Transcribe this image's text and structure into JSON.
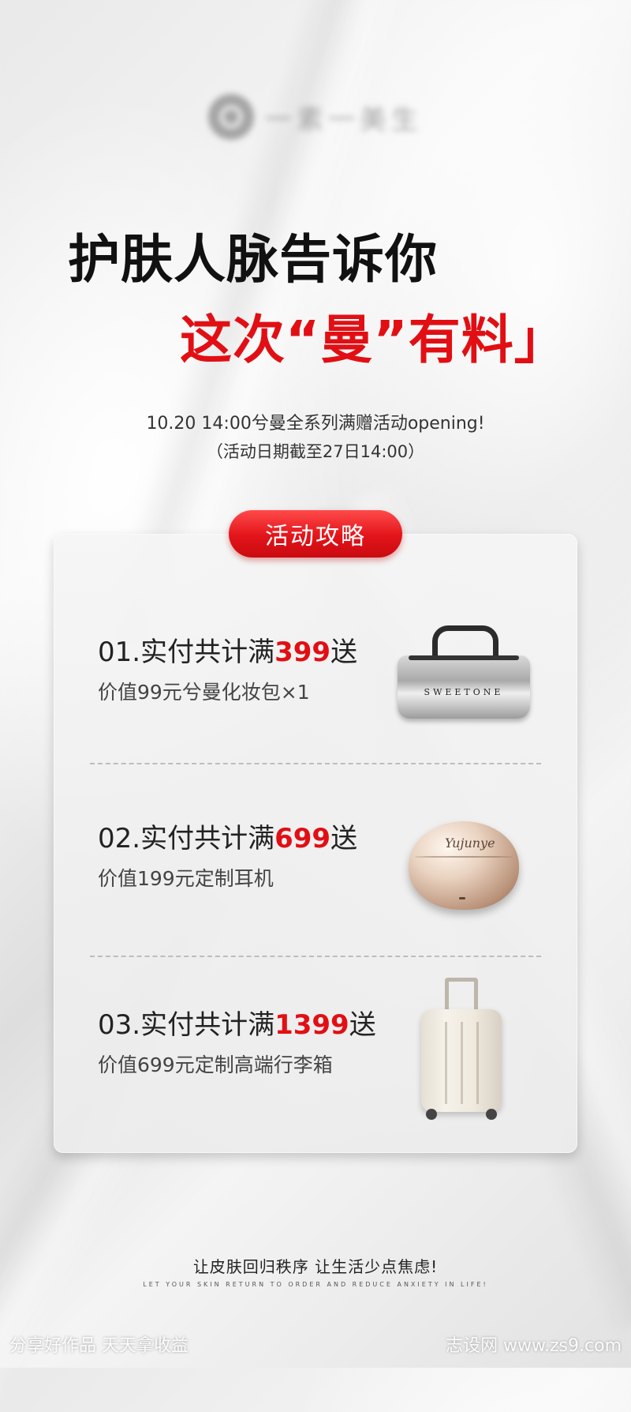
{
  "logo": {
    "text": "一素一美生"
  },
  "headline": {
    "line1": "护肤人脉告诉你",
    "line2": "这次“曼”有料」"
  },
  "subtitle": {
    "line1": "10.20 14:00兮曼全系列满赠活动opening!",
    "line2": "（活动日期截至27日14:00）"
  },
  "guide_label": "活动攻略",
  "offers": [
    {
      "prefix": "01.实付共计满",
      "amount": "399",
      "suffix": "送",
      "desc": "价值99元兮曼化妆包×1",
      "product_text": "SWEETONE"
    },
    {
      "prefix": "02.实付共计满",
      "amount": "699",
      "suffix": "送",
      "desc": "价值199元定制耳机",
      "product_text": "Yujunye"
    },
    {
      "prefix": "03.实付共计满",
      "amount": "1399",
      "suffix": "送",
      "desc": "价值699元定制高端行李箱"
    }
  ],
  "footer": {
    "slogan": "让皮肤回归秩序 让生活少点焦虑!",
    "slogan_en": "LET YOUR SKIN RETURN TO ORDER AND REDUCE ANXIETY IN LIFE!"
  },
  "watermark": {
    "left": "分享好作品 天天拿收益",
    "right": "志设网 www.zs9.com"
  },
  "colors": {
    "accent": "#e10f14",
    "text": "#222222",
    "card": "#efefef"
  }
}
